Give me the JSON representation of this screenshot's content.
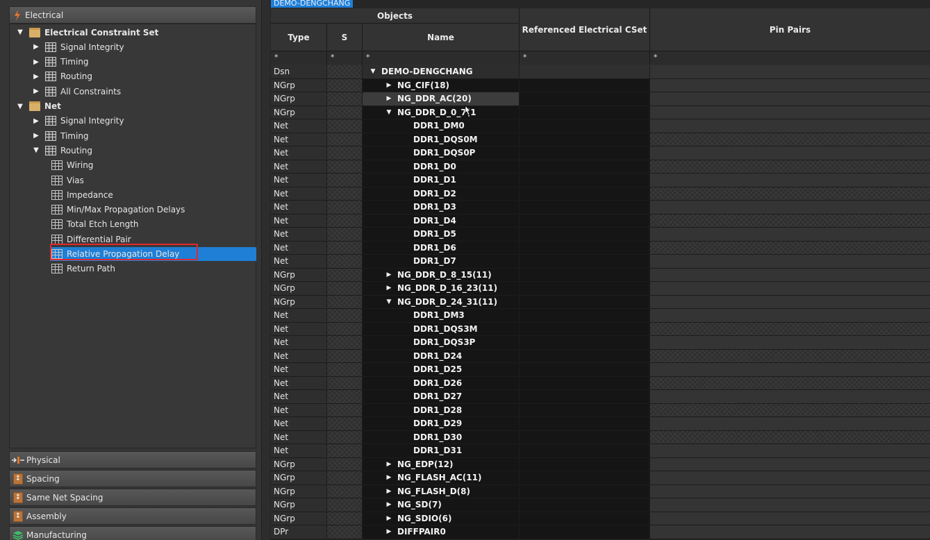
{
  "left_panel": {
    "electrical_header": "Electrical",
    "tree": [
      {
        "label": "Electrical Constraint Set",
        "level": 0,
        "expand": "open",
        "icon": "folder-icon",
        "bold": true
      },
      {
        "label": "Signal Integrity",
        "level": 1,
        "expand": "closed",
        "icon": "worksheet-group-icon"
      },
      {
        "label": "Timing",
        "level": 1,
        "expand": "closed",
        "icon": "worksheet-group-icon"
      },
      {
        "label": "Routing",
        "level": 1,
        "expand": "closed",
        "icon": "worksheet-group-icon"
      },
      {
        "label": "All Constraints",
        "level": 1,
        "expand": "closed",
        "icon": "worksheet-group-icon"
      },
      {
        "label": "Net",
        "level": 0,
        "expand": "open",
        "icon": "folder-icon",
        "bold": true
      },
      {
        "label": "Signal Integrity",
        "level": 1,
        "expand": "closed",
        "icon": "worksheet-group-icon"
      },
      {
        "label": "Timing",
        "level": 1,
        "expand": "closed",
        "icon": "worksheet-group-icon"
      },
      {
        "label": "Routing",
        "level": 1,
        "expand": "open",
        "icon": "worksheet-group-icon"
      },
      {
        "label": "Wiring",
        "level": 2,
        "expand": "none",
        "icon": "worksheet-icon"
      },
      {
        "label": "Vias",
        "level": 2,
        "expand": "none",
        "icon": "worksheet-icon"
      },
      {
        "label": "Impedance",
        "level": 2,
        "expand": "none",
        "icon": "worksheet-icon"
      },
      {
        "label": "Min/Max Propagation Delays",
        "level": 2,
        "expand": "none",
        "icon": "worksheet-icon"
      },
      {
        "label": "Total Etch Length",
        "level": 2,
        "expand": "none",
        "icon": "worksheet-icon"
      },
      {
        "label": "Differential Pair",
        "level": 2,
        "expand": "none",
        "icon": "worksheet-icon"
      },
      {
        "label": "Relative Propagation Delay",
        "level": 2,
        "expand": "none",
        "icon": "worksheet-icon",
        "selected": true
      },
      {
        "label": "Return Path",
        "level": 2,
        "expand": "none",
        "icon": "worksheet-icon"
      }
    ],
    "bottom_tabs": [
      {
        "label": "Physical",
        "icon": "physical-icon"
      },
      {
        "label": "Spacing",
        "icon": "spacing-icon"
      },
      {
        "label": "Same Net Spacing",
        "icon": "same-net-spacing-icon"
      },
      {
        "label": "Assembly",
        "icon": "assembly-icon"
      },
      {
        "label": "Manufacturing",
        "icon": "manufacturing-icon"
      }
    ],
    "colors": {
      "selection": "#1f7fd6",
      "highlight_box": "#e0292b"
    }
  },
  "worksheet": {
    "design_tab": "DEMO-DENGCHANG",
    "headers": {
      "objects": "Objects",
      "type": "Type",
      "s": "S",
      "name": "Name",
      "ref_cset": "Referenced Electrical CSet",
      "pin_pairs": "Pin Pairs"
    },
    "filters": {
      "type": "*",
      "s": "*",
      "name": "*",
      "ref_cset": "*",
      "pin_pairs": "*"
    },
    "rows": [
      {
        "type": "Dsn",
        "name": "DEMO-DENGCHANG",
        "indent": 0,
        "expand": "open",
        "kind": "dsn"
      },
      {
        "type": "NGrp",
        "name": "NG_CIF(18)",
        "indent": 1,
        "expand": "closed"
      },
      {
        "type": "NGrp",
        "name": "NG_DDR_AC(20)",
        "indent": 1,
        "expand": "closed",
        "hl": true
      },
      {
        "type": "NGrp",
        "name": "NG_DDR_D_0_7(1",
        "indent": 1,
        "expand": "open"
      },
      {
        "type": "Net",
        "name": "DDR1_DM0",
        "indent": 2,
        "expand": "none"
      },
      {
        "type": "Net",
        "name": "DDR1_DQS0M",
        "indent": 2,
        "expand": "none"
      },
      {
        "type": "Net",
        "name": "DDR1_DQS0P",
        "indent": 2,
        "expand": "none"
      },
      {
        "type": "Net",
        "name": "DDR1_D0",
        "indent": 2,
        "expand": "none"
      },
      {
        "type": "Net",
        "name": "DDR1_D1",
        "indent": 2,
        "expand": "none"
      },
      {
        "type": "Net",
        "name": "DDR1_D2",
        "indent": 2,
        "expand": "none"
      },
      {
        "type": "Net",
        "name": "DDR1_D3",
        "indent": 2,
        "expand": "none"
      },
      {
        "type": "Net",
        "name": "DDR1_D4",
        "indent": 2,
        "expand": "none"
      },
      {
        "type": "Net",
        "name": "DDR1_D5",
        "indent": 2,
        "expand": "none"
      },
      {
        "type": "Net",
        "name": "DDR1_D6",
        "indent": 2,
        "expand": "none"
      },
      {
        "type": "Net",
        "name": "DDR1_D7",
        "indent": 2,
        "expand": "none"
      },
      {
        "type": "NGrp",
        "name": "NG_DDR_D_8_15(11)",
        "indent": 1,
        "expand": "closed"
      },
      {
        "type": "NGrp",
        "name": "NG_DDR_D_16_23(11)",
        "indent": 1,
        "expand": "closed"
      },
      {
        "type": "NGrp",
        "name": "NG_DDR_D_24_31(11)",
        "indent": 1,
        "expand": "open"
      },
      {
        "type": "Net",
        "name": "DDR1_DM3",
        "indent": 2,
        "expand": "none"
      },
      {
        "type": "Net",
        "name": "DDR1_DQS3M",
        "indent": 2,
        "expand": "none"
      },
      {
        "type": "Net",
        "name": "DDR1_DQS3P",
        "indent": 2,
        "expand": "none"
      },
      {
        "type": "Net",
        "name": "DDR1_D24",
        "indent": 2,
        "expand": "none"
      },
      {
        "type": "Net",
        "name": "DDR1_D25",
        "indent": 2,
        "expand": "none"
      },
      {
        "type": "Net",
        "name": "DDR1_D26",
        "indent": 2,
        "expand": "none"
      },
      {
        "type": "Net",
        "name": "DDR1_D27",
        "indent": 2,
        "expand": "none"
      },
      {
        "type": "Net",
        "name": "DDR1_D28",
        "indent": 2,
        "expand": "none"
      },
      {
        "type": "Net",
        "name": "DDR1_D29",
        "indent": 2,
        "expand": "none"
      },
      {
        "type": "Net",
        "name": "DDR1_D30",
        "indent": 2,
        "expand": "none"
      },
      {
        "type": "Net",
        "name": "DDR1_D31",
        "indent": 2,
        "expand": "none"
      },
      {
        "type": "NGrp",
        "name": "NG_EDP(12)",
        "indent": 1,
        "expand": "closed"
      },
      {
        "type": "NGrp",
        "name": "NG_FLASH_AC(11)",
        "indent": 1,
        "expand": "closed"
      },
      {
        "type": "NGrp",
        "name": "NG_FLASH_D(8)",
        "indent": 1,
        "expand": "closed"
      },
      {
        "type": "NGrp",
        "name": "NG_SD(7)",
        "indent": 1,
        "expand": "closed"
      },
      {
        "type": "NGrp",
        "name": "NG_SDIO(6)",
        "indent": 1,
        "expand": "closed"
      },
      {
        "type": "DPr",
        "name": "DIFFPAIR0",
        "indent": 1,
        "expand": "closed"
      }
    ]
  }
}
